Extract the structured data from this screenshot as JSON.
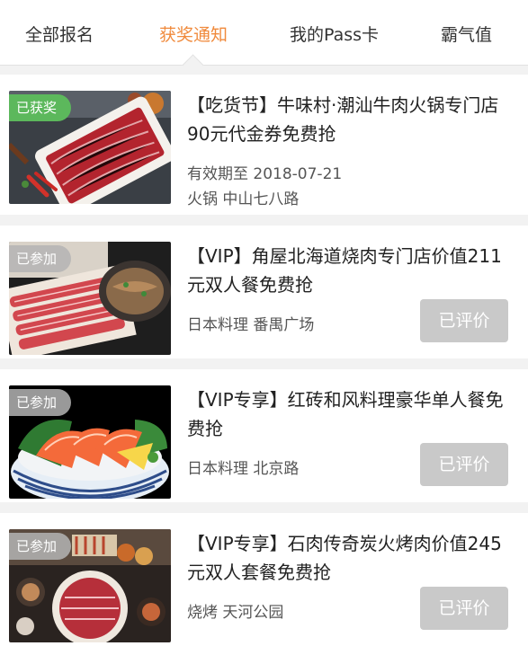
{
  "tabs": [
    {
      "label": "全部报名",
      "active": false
    },
    {
      "label": "获奖通知",
      "active": true
    },
    {
      "label": "我的Pass卡",
      "active": false
    },
    {
      "label": "霸气值",
      "active": false
    }
  ],
  "accent_color": "#f08a3c",
  "cards": [
    {
      "badge": "已获奖",
      "title": "【吃货节】牛味村·潮汕牛肉火锅专门店90元代金券免费抢",
      "validity": "有效期至 2018-07-21",
      "location": "火锅 中山七八路",
      "image": "beef-slices-plate"
    },
    {
      "badge": "已参加",
      "title": "【VIP】角屋北海道烧肉专门店价值211元双人餐免费抢",
      "location": "日本料理 番禺广场",
      "button": "已评价",
      "image": "bbq-meat-platter"
    },
    {
      "badge": "已参加",
      "title": "【VIP专享】红砖和风料理豪华单人餐免费抢",
      "location": "日本料理 北京路",
      "button": "已评价",
      "image": "salmon-sashimi-bowl"
    },
    {
      "badge": "已参加",
      "title": "【VIP专享】石肉传奇炭火烤肉价值245元双人套餐免费抢",
      "location": "烧烤 天河公园",
      "button": "已评价",
      "image": "grill-meat-set"
    }
  ]
}
